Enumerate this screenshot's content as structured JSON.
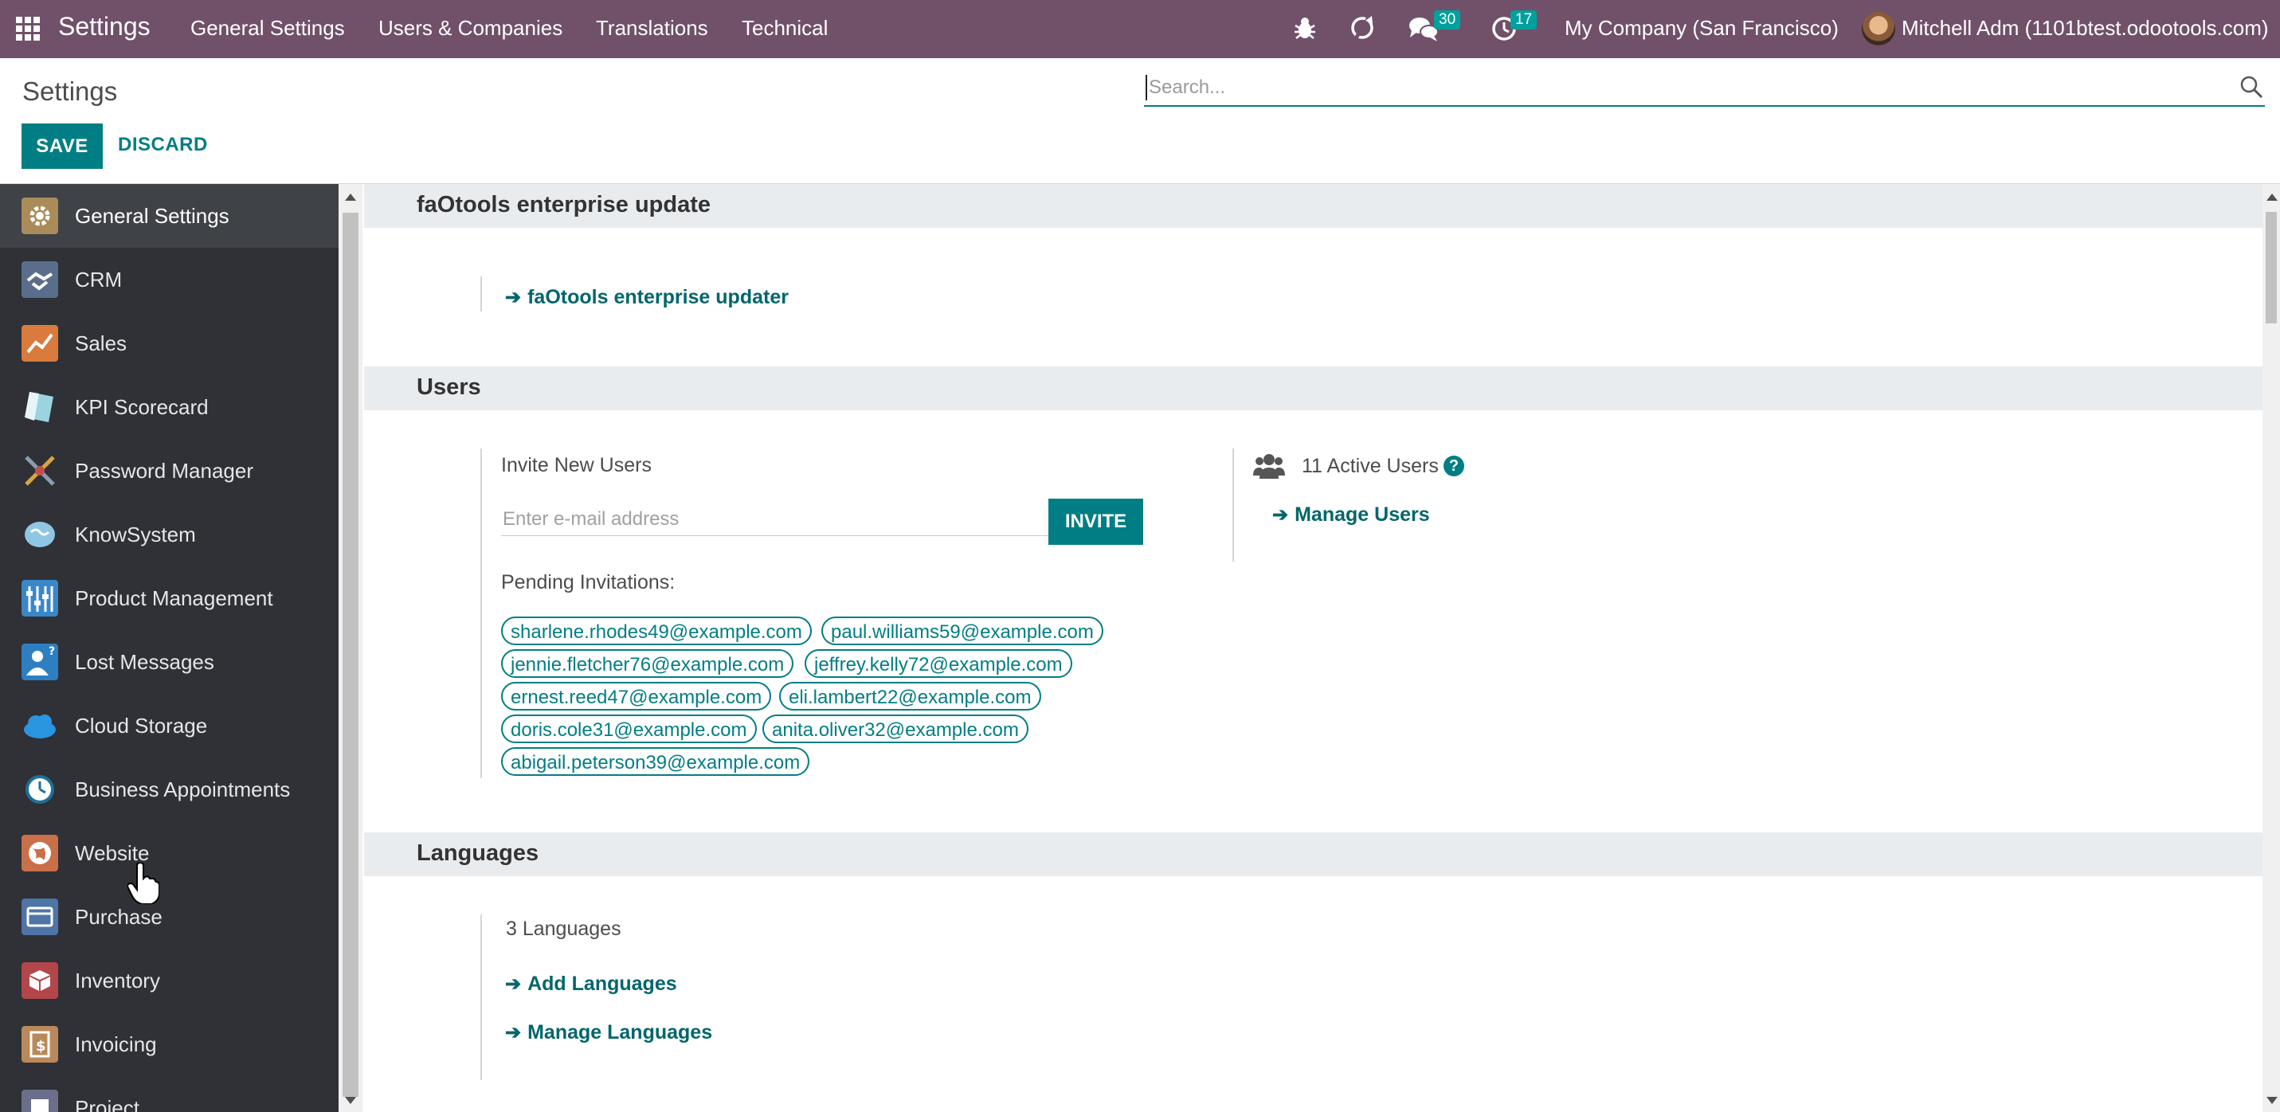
{
  "navbar": {
    "brand": "Settings",
    "menu": [
      "General Settings",
      "Users & Companies",
      "Translations",
      "Technical"
    ],
    "messages_count": "30",
    "activities_count": "17",
    "company": "My Company (San Francisco)",
    "user": "Mitchell Adm (1101btest.odootools.com)",
    "background": "#71506a"
  },
  "control_panel": {
    "title": "Settings",
    "save_label": "SAVE",
    "discard_label": "DISCARD",
    "search_placeholder": "Search...",
    "accent": "#017e84"
  },
  "sidebar": {
    "items": [
      {
        "label": "General Settings",
        "icon": "gear-icon",
        "active": true
      },
      {
        "label": "CRM",
        "icon": "handshake-icon"
      },
      {
        "label": "Sales",
        "icon": "chart-icon"
      },
      {
        "label": "KPI Scorecard",
        "icon": "scorecard-icon"
      },
      {
        "label": "Password Manager",
        "icon": "keys-icon"
      },
      {
        "label": "KnowSystem",
        "icon": "brain-icon"
      },
      {
        "label": "Product Management",
        "icon": "sliders-icon"
      },
      {
        "label": "Lost Messages",
        "icon": "question-person-icon"
      },
      {
        "label": "Cloud Storage",
        "icon": "cloud-icon"
      },
      {
        "label": "Business Appointments",
        "icon": "clock-icon"
      },
      {
        "label": "Website",
        "icon": "globe-icon"
      },
      {
        "label": "Purchase",
        "icon": "card-icon"
      },
      {
        "label": "Inventory",
        "icon": "box-icon"
      },
      {
        "label": "Invoicing",
        "icon": "invoice-icon"
      },
      {
        "label": "Project",
        "icon": "puzzle-icon"
      }
    ]
  },
  "sections": {
    "enterprise": {
      "title": "faOtools enterprise update",
      "link": "faOtools enterprise updater"
    },
    "users": {
      "title": "Users",
      "invite_label": "Invite New Users",
      "email_placeholder": "Enter e-mail address",
      "invite_button": "INVITE",
      "pending_label": "Pending Invitations:",
      "pending": [
        "sharlene.rhodes49@example.com",
        "paul.williams59@example.com",
        "jennie.fletcher76@example.com",
        "jeffrey.kelly72@example.com",
        "ernest.reed47@example.com",
        "eli.lambert22@example.com",
        "doris.cole31@example.com",
        "anita.oliver32@example.com",
        "abigail.peterson39@example.com"
      ],
      "active_users": "11 Active Users",
      "manage_users": "Manage Users"
    },
    "languages": {
      "title": "Languages",
      "count": "3 Languages",
      "add_link": "Add Languages",
      "manage_link": "Manage Languages"
    }
  }
}
